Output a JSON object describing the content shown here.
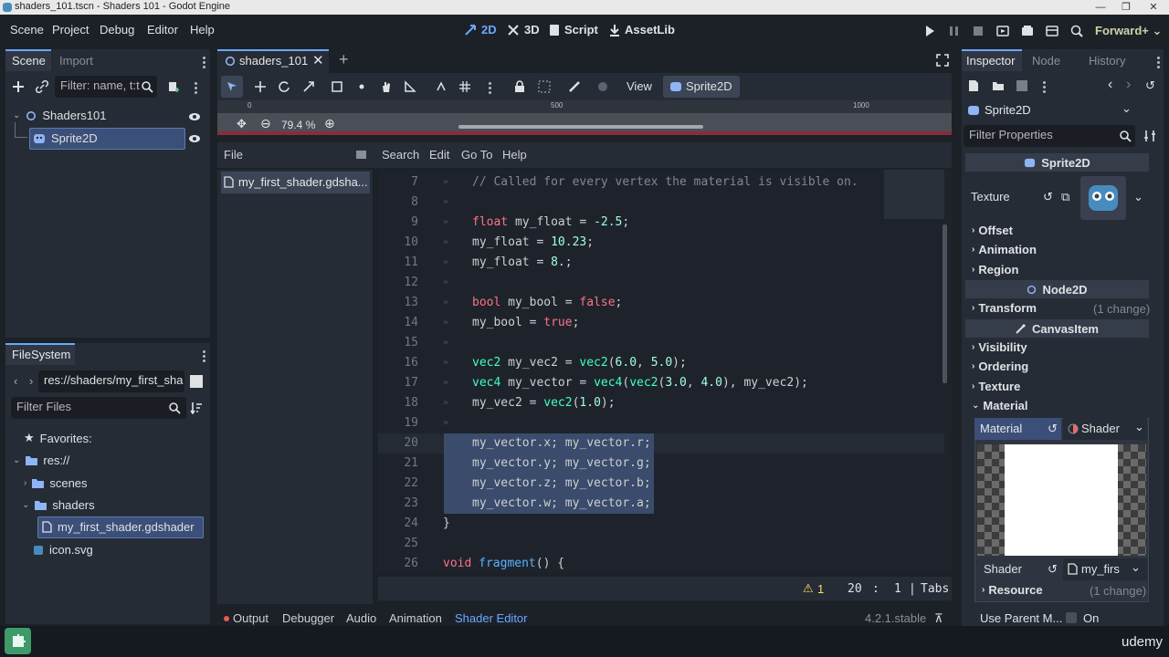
{
  "window": {
    "title": "shaders_101.tscn - Shaders 101 - Godot Engine",
    "controls": [
      "—",
      "❐",
      "✕"
    ]
  },
  "menu": [
    "Scene",
    "Project",
    "Debug",
    "Editor",
    "Help"
  ],
  "workspaces": [
    {
      "label": "2D",
      "active": true
    },
    {
      "label": "3D",
      "active": false
    },
    {
      "label": "Script",
      "active": false
    },
    {
      "label": "AssetLib",
      "active": false
    }
  ],
  "renderer": "Forward+",
  "scene_dock": {
    "tabs": [
      "Scene",
      "Import"
    ],
    "filter_placeholder": "Filter: name, t:t",
    "nodes": [
      {
        "name": "Shaders101",
        "icon": "node2d-icon"
      },
      {
        "name": "Sprite2D",
        "icon": "sprite2d-icon",
        "selected": true
      }
    ]
  },
  "filesystem_dock": {
    "tab": "FileSystem",
    "path": "res://shaders/my_first_sha",
    "filter_placeholder": "Filter Files",
    "favorites_label": "Favorites:",
    "tree": [
      {
        "name": "res://",
        "type": "folder"
      },
      {
        "name": "scenes",
        "type": "folder"
      },
      {
        "name": "shaders",
        "type": "folder"
      },
      {
        "name": "my_first_shader.gdshader",
        "type": "file",
        "selected": true
      },
      {
        "name": "icon.svg",
        "type": "file"
      }
    ]
  },
  "scene_tab": {
    "name": "shaders_101"
  },
  "toolbar_2d": {
    "view_label": "View",
    "sprite_label": "Sprite2D",
    "zoom": "79.4 %",
    "ruler": [
      "0",
      "500",
      "1000"
    ]
  },
  "shader_editor": {
    "menu": [
      "File",
      "Search",
      "Edit",
      "Go To",
      "Help"
    ],
    "open_file": "my_first_shader.gdsha...",
    "lines": [
      {
        "n": "7",
        "text": "// Called for every vertex the material is visible on."
      },
      {
        "n": "8",
        "text": ""
      },
      {
        "n": "9",
        "text": "float my_float = -2.5;"
      },
      {
        "n": "10",
        "text": "my_float = 10.23;"
      },
      {
        "n": "11",
        "text": "my_float = 8.;"
      },
      {
        "n": "12",
        "text": ""
      },
      {
        "n": "13",
        "text": "bool my_bool = false;"
      },
      {
        "n": "14",
        "text": "my_bool = true;"
      },
      {
        "n": "15",
        "text": ""
      },
      {
        "n": "16",
        "text": "vec2 my_vec2 = vec2(6.0, 5.0);"
      },
      {
        "n": "17",
        "text": "vec4 my_vector = vec4(vec2(3.0, 4.0), my_vec2);"
      },
      {
        "n": "18",
        "text": "my_vec2 = vec2(1.0);"
      },
      {
        "n": "19",
        "text": ""
      },
      {
        "n": "20",
        "text": "my_vector.x; my_vector.r;"
      },
      {
        "n": "21",
        "text": "my_vector.y; my_vector.g;"
      },
      {
        "n": "22",
        "text": "my_vector.z; my_vector.b;"
      },
      {
        "n": "23",
        "text": "my_vector.w; my_vector.a;"
      },
      {
        "n": "24",
        "text": "}"
      },
      {
        "n": "25",
        "text": ""
      },
      {
        "n": "26",
        "text": "void fragment() {"
      }
    ],
    "status": {
      "warnings": "1",
      "line": "20",
      "col": "1",
      "indent": "Tabs"
    }
  },
  "bottom_panel": {
    "tabs": [
      "Output",
      "Debugger",
      "Audio",
      "Animation",
      "Shader Editor"
    ],
    "version": "4.2.1.stable"
  },
  "inspector": {
    "tabs": [
      "Inspector",
      "Node",
      "History"
    ],
    "object": "Sprite2D",
    "filter_placeholder": "Filter Properties",
    "class_header": "Sprite2D",
    "texture_label": "Texture",
    "sections_top": [
      "Offset",
      "Animation",
      "Region"
    ],
    "node2d_header": "Node2D",
    "transform": {
      "label": "Transform",
      "change": "(1 change)"
    },
    "canvasitem_header": "CanvasItem",
    "sections_mid": [
      "Visibility",
      "Ordering",
      "Texture",
      "Material"
    ],
    "material": {
      "label": "Material",
      "type": "Shader"
    },
    "shader": {
      "label": "Shader",
      "value": "my_firs"
    },
    "resource": {
      "label": "Resource",
      "change": "(1 change)"
    },
    "use_parent": {
      "label": "Use Parent M...",
      "value": "On"
    }
  },
  "watermark": "udemy",
  "colors": {
    "accent": "#6aa8ff",
    "selection": "#3a4b6b",
    "keyword": "#ff7085",
    "type": "#42ffc2",
    "number": "#a1ffe0"
  }
}
